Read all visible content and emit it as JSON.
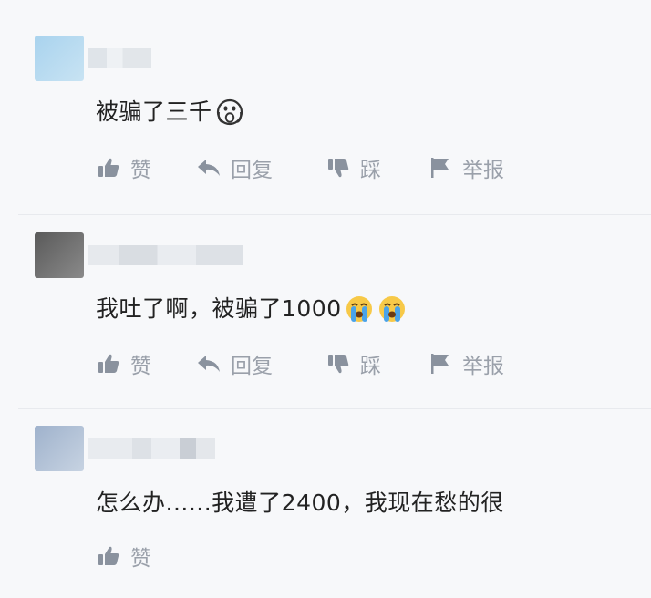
{
  "comments": [
    {
      "text": "被骗了三千",
      "emoji": [
        "scream-face-icon"
      ],
      "actions": {
        "like": "赞",
        "reply": "回复",
        "dislike": "踩",
        "report": "举报"
      }
    },
    {
      "text": "我吐了啊，被骗了1000",
      "emoji": [
        "crying-face-icon",
        "crying-face-icon"
      ],
      "actions": {
        "like": "赞",
        "reply": "回复",
        "dislike": "踩",
        "report": "举报"
      }
    },
    {
      "text": "怎么办......我遭了2400，我现在愁的很",
      "emoji": [],
      "actions": {
        "like": "赞"
      }
    }
  ],
  "colors": {
    "background": "#f7f8fa",
    "text": "#222222",
    "action_text": "#9aa0aa",
    "action_icon": "#8a929e",
    "divider": "#e8eaee"
  }
}
